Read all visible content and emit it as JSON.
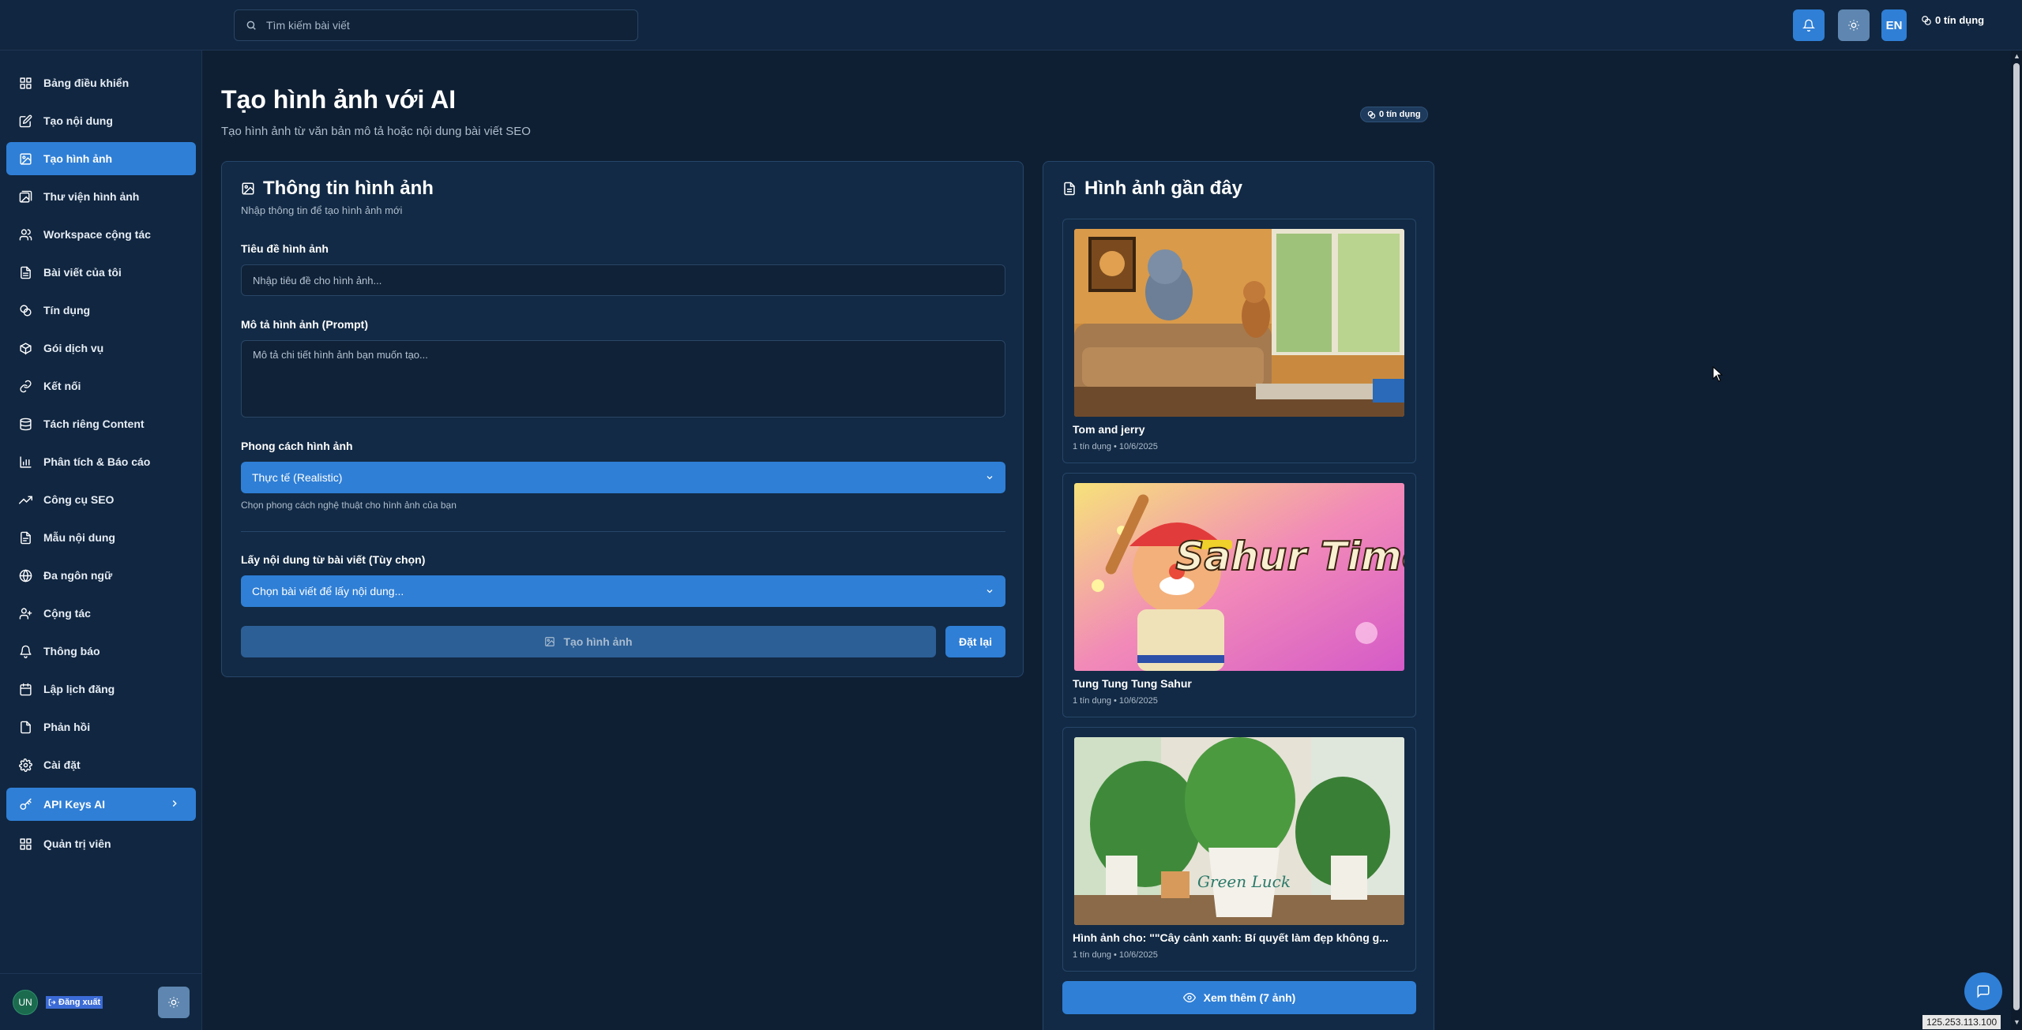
{
  "topbar": {
    "search_placeholder": "Tìm kiếm bài viết",
    "lang": "EN",
    "credits": "0 tín dụng"
  },
  "sidebar": {
    "items": [
      {
        "label": "Bảng điều khiển",
        "icon": "dashboard-icon"
      },
      {
        "label": "Tạo nội dung",
        "icon": "edit-icon"
      },
      {
        "label": "Tạo hình ảnh",
        "icon": "image-icon",
        "active": true
      },
      {
        "label": "Thư viện hình ảnh",
        "icon": "image-library-icon"
      },
      {
        "label": "Workspace cộng tác",
        "icon": "users-icon"
      },
      {
        "label": "Bài viết của tôi",
        "icon": "document-icon"
      },
      {
        "label": "Tín dụng",
        "icon": "coins-icon"
      },
      {
        "label": "Gói dịch vụ",
        "icon": "package-icon"
      },
      {
        "label": "Kết nối",
        "icon": "link-icon"
      },
      {
        "label": "Tách riêng Content",
        "icon": "database-icon"
      },
      {
        "label": "Phân tích & Báo cáo",
        "icon": "bar-chart-icon"
      },
      {
        "label": "Công cụ SEO",
        "icon": "trending-up-icon"
      },
      {
        "label": "Mẫu nội dung",
        "icon": "template-icon"
      },
      {
        "label": "Đa ngôn ngữ",
        "icon": "globe-icon"
      },
      {
        "label": "Cộng tác",
        "icon": "collab-icon"
      },
      {
        "label": "Thông báo",
        "icon": "bell-icon"
      },
      {
        "label": "Lập lịch đăng",
        "icon": "calendar-icon"
      },
      {
        "label": "Phản hồi",
        "icon": "feedback-icon"
      },
      {
        "label": "Cài đặt",
        "icon": "gear-icon"
      },
      {
        "label": "API Keys AI",
        "icon": "key-icon",
        "active": true,
        "has_chevron": true
      },
      {
        "label": "Quản trị viên",
        "icon": "admin-icon"
      }
    ],
    "user_initials": "UN",
    "logout_label": "Đăng xuất"
  },
  "page": {
    "title": "Tạo hình ảnh với AI",
    "subtitle": "Tạo hình ảnh từ văn bản mô tả hoặc nội dung bài viết SEO",
    "credit_badge": "0 tín dụng"
  },
  "form": {
    "title": "Thông tin hình ảnh",
    "subtitle": "Nhập thông tin để tạo hình ảnh mới",
    "title_label": "Tiêu đề hình ảnh",
    "title_placeholder": "Nhập tiêu đề cho hình ảnh...",
    "prompt_label": "Mô tả hình ảnh (Prompt)",
    "prompt_placeholder": "Mô tả chi tiết hình ảnh bạn muốn tạo...",
    "style_label": "Phong cách hình ảnh",
    "style_value": "Thực tế (Realistic)",
    "style_hint": "Chọn phong cách nghệ thuật cho hình ảnh của bạn",
    "article_label": "Lấy nội dung từ bài viết (Tùy chọn)",
    "article_value": "Chọn bài viết để lấy nội dung...",
    "generate_label": "Tạo hình ảnh",
    "reset_label": "Đặt lại"
  },
  "recent": {
    "title": "Hình ảnh gần đây",
    "items": [
      {
        "name": "Tom and jerry",
        "meta": "1 tín dụng • 10/6/2025",
        "image": "tom-and-jerry-cartoon-living-room"
      },
      {
        "name": "Tung Tung Tung Sahur",
        "meta": "1 tín dụng • 10/6/2025",
        "image": "cartoon-baseball-character-sahur-time",
        "image_text": "Sahur Time!"
      },
      {
        "name": "Hình ảnh cho: \"\"Cây cảnh xanh: Bí quyết làm đẹp không g...",
        "meta": "1 tín dụng • 10/6/2025",
        "image": "potted-houseplants-green-luck",
        "image_text": "Green Luck"
      }
    ],
    "more_label": "Xem thêm (7 ảnh)"
  },
  "ip_address": "125.253.113.100",
  "colors": {
    "background": "#0f1f33",
    "panel": "#112640",
    "card": "#122a45",
    "accent": "#2f7fd6"
  }
}
